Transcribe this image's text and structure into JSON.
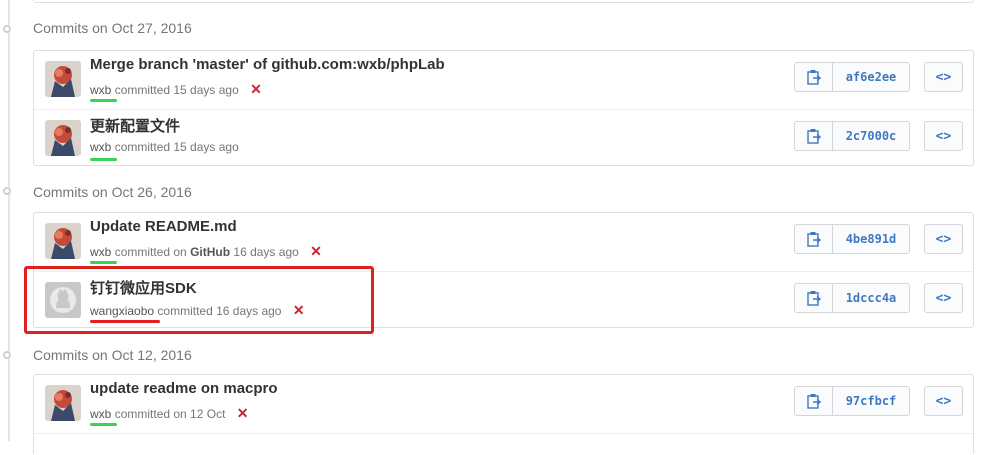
{
  "colors": {
    "underline_green": "#39d353",
    "underline_red": "#e0201f",
    "highlight_box": "#e0201f",
    "sha_link": "#4078c0",
    "unverified_x": "#cb2431"
  },
  "groups": [
    {
      "label": "Commits on Oct 27, 2016",
      "commits": [
        {
          "title": "Merge branch 'master' of github.com:wxb/phpLab",
          "author": "wxb",
          "meta_text": "committed 15 days ago",
          "sha": "af6e2ee",
          "status_icon": "x-icon"
        },
        {
          "title": "更新配置文件",
          "author": "wxb",
          "meta_text": "committed 15 days ago",
          "sha": "2c7000c",
          "status_icon": "none"
        }
      ]
    },
    {
      "label": "Commits on Oct 26, 2016",
      "commits": [
        {
          "title": "Update README.md",
          "author": "wxb",
          "meta_pre": "committed on",
          "meta_bold": "GitHub",
          "meta_post": "16 days ago",
          "sha": "4be891d",
          "status_icon": "x-icon"
        },
        {
          "title": "钉钉微应用SDK",
          "author": "wangxiaobo",
          "meta_text": "committed 16 days ago",
          "sha": "1dccc4a",
          "status_icon": "x-icon"
        }
      ]
    },
    {
      "label": "Commits on Oct 12, 2016",
      "commits": [
        {
          "title": "update readme on macpro",
          "author": "wxb",
          "meta_text": "committed on 12 Oct",
          "sha": "97cfbcf",
          "status_icon": "x-icon"
        }
      ]
    }
  ],
  "icons": {
    "copy": "clipboard-icon",
    "browse": "code-icon",
    "browse_glyph": "<>",
    "unverified_glyph": "✕"
  }
}
